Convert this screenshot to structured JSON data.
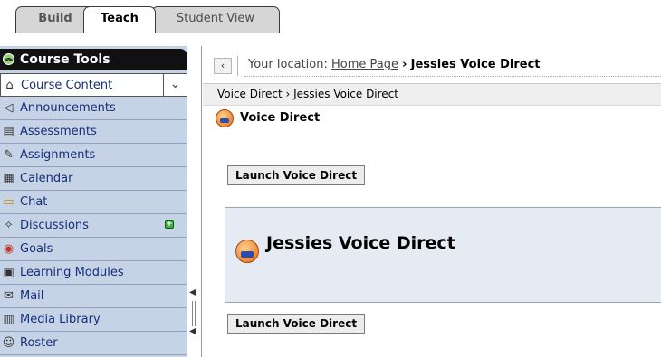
{
  "tabs": [
    {
      "label": "Build"
    },
    {
      "label": "Teach"
    },
    {
      "label": "Student View"
    }
  ],
  "sidebar": {
    "title": "Course Tools",
    "items": [
      {
        "label": "Course Content",
        "icon": "house-icon",
        "active": true
      },
      {
        "label": "Announcements",
        "icon": "megaphone-icon"
      },
      {
        "label": "Assessments",
        "icon": "clipboard-icon"
      },
      {
        "label": "Assignments",
        "icon": "pencil-icon"
      },
      {
        "label": "Calendar",
        "icon": "calendar-icon"
      },
      {
        "label": "Chat",
        "icon": "chat-bubble-icon"
      },
      {
        "label": "Discussions",
        "icon": "push-pin-icon"
      },
      {
        "label": "Goals",
        "icon": "target-icon"
      },
      {
        "label": "Learning Modules",
        "icon": "document-icon"
      },
      {
        "label": "Mail",
        "icon": "mail-icon"
      },
      {
        "label": "Media Library",
        "icon": "media-icon"
      },
      {
        "label": "Roster",
        "icon": "people-icon"
      }
    ]
  },
  "location": {
    "prefix": "Your location:",
    "home_link": "Home Page",
    "separator": "›",
    "current": "Jessies Voice Direct"
  },
  "breadcrumb": "Voice Direct › Jessies Voice Direct",
  "tool_title": "Voice Direct",
  "launch_button_label": "Launch Voice Direct",
  "panel_title": "Jessies Voice Direct"
}
